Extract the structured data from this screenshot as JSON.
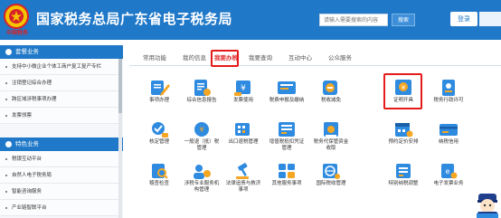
{
  "header": {
    "logo_caption": "中国税务",
    "title": "国家税务总局广东省电子税务局",
    "search_placeholder": "请输入需要搜索的内容",
    "search_button": "搜索",
    "login_button": "登录",
    "colors": {
      "header_bg": "#1f78c8",
      "highlight": "#e51a1a",
      "active_tab": "#e12a2a"
    }
  },
  "sidebar": {
    "sections": [
      {
        "title": "套餐业务",
        "icon": "package-icon",
        "items": [
          "支持中小微企业个体工商户复工复产专栏",
          "注销登记综合办理",
          "跨区域涉税事项办理",
          "发票领票"
        ]
      },
      {
        "title": "特色业务",
        "icon": "star-icon",
        "items": [
          "税银互动平台",
          "自然人电子税务局",
          "智能咨询服务",
          "产业链智联平台"
        ]
      }
    ]
  },
  "tabs": [
    "常用功能",
    "我的信息",
    "我要办税",
    "我要查询",
    "互动中心",
    "公众服务"
  ],
  "active_tab": "我要办税",
  "grid": {
    "row1": [
      {
        "label": "事项办理",
        "icon": "pencil-icon"
      },
      {
        "label": "综合信息报告",
        "icon": "document-icon"
      },
      {
        "label": "发票使用",
        "icon": "invoice-icon"
      },
      {
        "label": "税费申报及缴纳",
        "icon": "tax-declare-icon"
      },
      {
        "label": "税收减免",
        "icon": "tax-relief-icon"
      },
      {
        "label": "证明开具",
        "icon": "certificate-icon"
      },
      {
        "label": "税务行政许可",
        "icon": "admin-permit-icon"
      }
    ],
    "row2": [
      {
        "label": "核定管理",
        "icon": "approval-icon"
      },
      {
        "label": "一般退（抵）税",
        "label2": "管理",
        "icon": "refund-icon"
      },
      {
        "label": "出口退税管理",
        "icon": "export-refund-icon"
      },
      {
        "label": "增值税抵扣凭证",
        "label2": "管理",
        "icon": "vat-deduct-icon"
      },
      {
        "label": "税务代保管资金",
        "label2": "收取",
        "icon": "custody-icon"
      },
      {
        "label": "预约定价安排",
        "icon": "pricing-icon"
      },
      {
        "label": "纳税信用",
        "icon": "credit-icon"
      }
    ],
    "row3": [
      {
        "label": "稽查检查",
        "icon": "inspection-icon"
      },
      {
        "label": "涉税专业服务机",
        "label2": "构管理",
        "icon": "agency-icon"
      },
      {
        "label": "法律追责与救济",
        "label2": "事项",
        "icon": "legal-icon"
      },
      {
        "label": "其他服务事项",
        "icon": "other-service-icon"
      },
      {
        "label": "国际税收管理",
        "icon": "international-icon"
      },
      {
        "label": "特别纳税调整",
        "icon": "special-adjust-icon"
      },
      {
        "label": "电子发票业务",
        "icon": "einvoice-icon"
      }
    ]
  }
}
